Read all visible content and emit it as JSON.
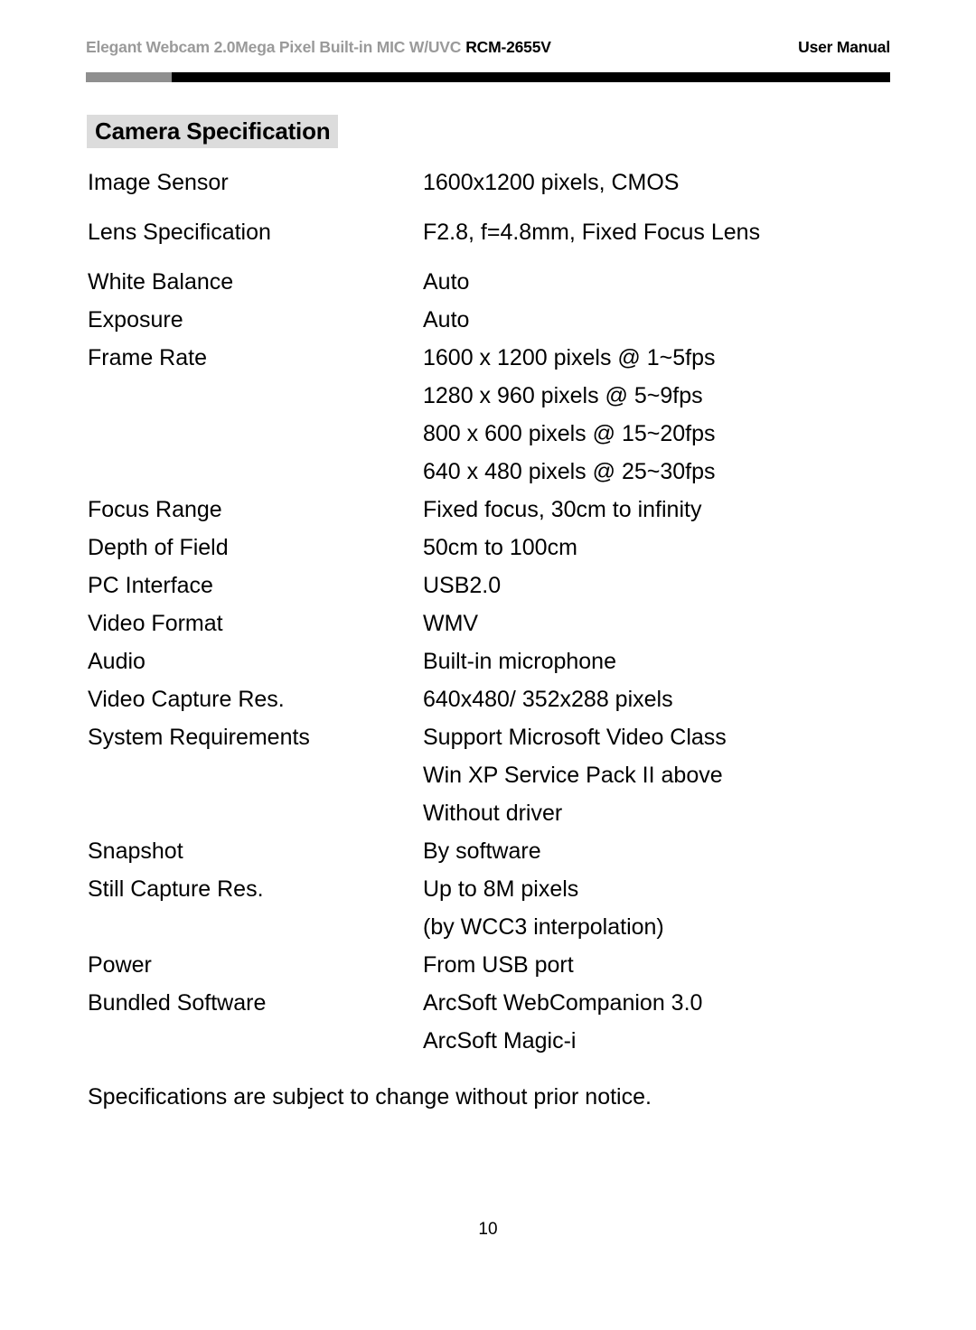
{
  "header": {
    "product_line": "Elegant Webcam 2.0Mega Pixel Built-in MIC W/UVC",
    "model": "RCM-2655V",
    "doc_type": "User Manual",
    "product_line_color": "#9a9a9a",
    "model_color": "#000000",
    "rule_gray_color": "#8f8f8f",
    "rule_black_color": "#000000"
  },
  "section": {
    "title": "Camera Specification",
    "highlight_color": "#dcdcdc"
  },
  "spec": {
    "rows": [
      {
        "label": "Image Sensor",
        "values": [
          "1600x1200 pixels, CMOS"
        ]
      },
      {
        "label": "Lens Specification",
        "values": [
          "F2.8, f=4.8mm, Fixed Focus Lens"
        ]
      },
      {
        "label": "White Balance",
        "values": [
          "Auto"
        ]
      },
      {
        "label": "Exposure",
        "values": [
          "Auto"
        ]
      },
      {
        "label": "Frame Rate",
        "values": [
          "1600 x 1200 pixels @ 1~5fps",
          "1280 x 960 pixels @ 5~9fps",
          "800 x 600 pixels @ 15~20fps",
          "640 x 480 pixels @ 25~30fps"
        ]
      },
      {
        "label": "Focus Range",
        "values": [
          "Fixed focus, 30cm to infinity"
        ]
      },
      {
        "label": "Depth of Field",
        "values": [
          "50cm to 100cm"
        ]
      },
      {
        "label": "PC Interface",
        "values": [
          "USB2.0"
        ]
      },
      {
        "label": "Video Format",
        "values": [
          "WMV"
        ]
      },
      {
        "label": "Audio",
        "values": [
          "Built-in microphone"
        ]
      },
      {
        "label": "Video Capture Res.",
        "values": [
          "640x480/ 352x288 pixels"
        ]
      },
      {
        "label": "System Requirements",
        "values": [
          "Support Microsoft Video Class",
          "Win XP Service Pack II above",
          "Without driver"
        ]
      },
      {
        "label": "Snapshot",
        "values": [
          "By software"
        ]
      },
      {
        "label": "Still Capture Res.",
        "values": [
          "Up to 8M pixels",
          "(by WCC3 interpolation)"
        ]
      },
      {
        "label": "Power",
        "values": [
          "From USB port"
        ]
      },
      {
        "label": "Bundled Software",
        "values": [
          "ArcSoft WebCompanion 3.0",
          "ArcSoft Magic-i"
        ]
      }
    ]
  },
  "footer": {
    "note": "Specifications are subject to change without prior notice.",
    "page_number": "10"
  }
}
